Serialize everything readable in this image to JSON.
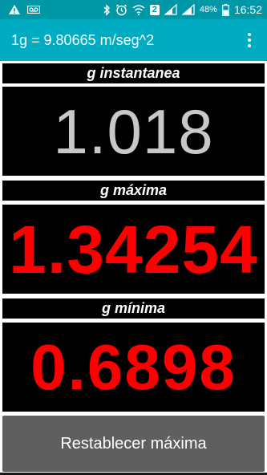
{
  "status_bar": {
    "icons": [
      "warning-icon",
      "voicemail-icon",
      "bluetooth-icon",
      "alarm-icon",
      "wifi-icon",
      "sim2-icon",
      "signal-icon",
      "battery-icon"
    ],
    "sim_badge": "2",
    "battery_percent": "48%",
    "time": "16:52",
    "background_color": "#0097a7"
  },
  "app_bar": {
    "title": "1g = 9.80665 m/seg^2",
    "menu_icon": "overflow-menu-icon",
    "background_color": "#00acc1"
  },
  "panels": {
    "instant": {
      "label": "g instantanea",
      "value": "1.018",
      "value_color": "#c8c8c8"
    },
    "max": {
      "label": "g máxima",
      "value": "1.34254",
      "value_color": "#ff0000"
    },
    "min": {
      "label": "g mínima",
      "value": "0.6898",
      "value_color": "#ff0000"
    }
  },
  "reset_button": {
    "label": "Restablecer máxima"
  }
}
